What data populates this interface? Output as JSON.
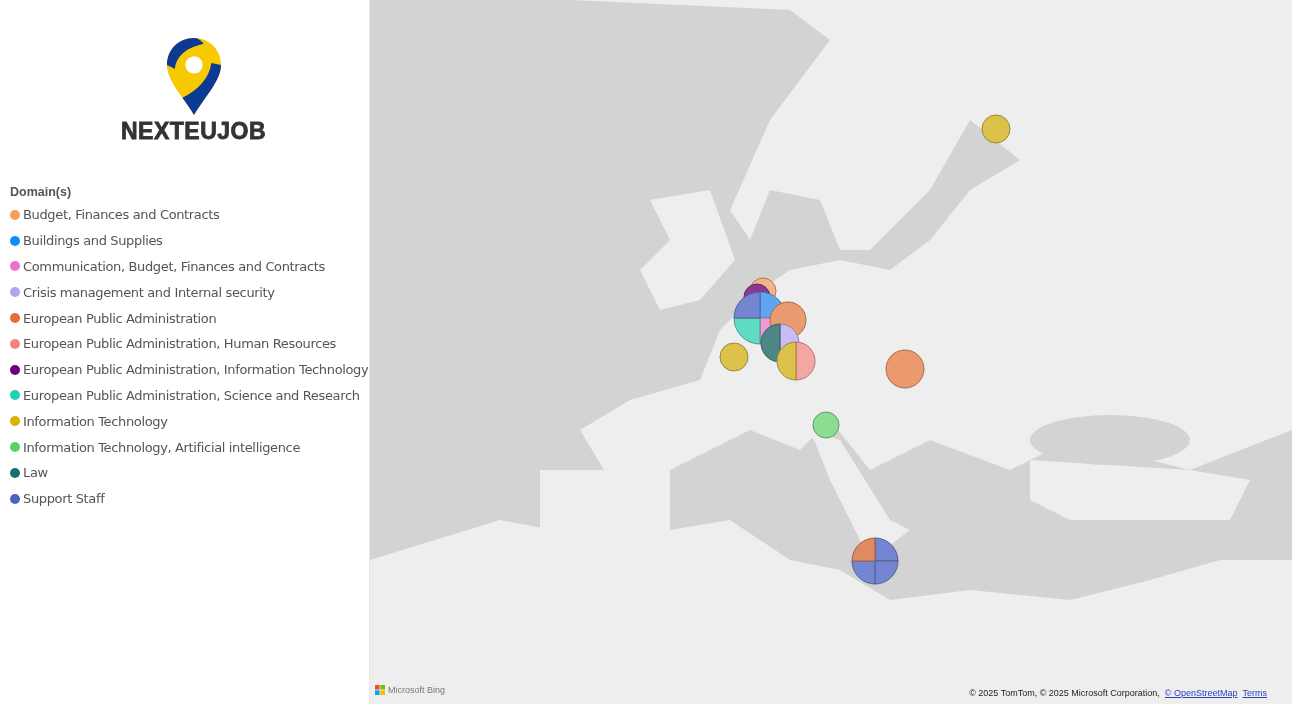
{
  "logo": {
    "name": "NEXTEUJOB"
  },
  "legend": {
    "title": "Domain(s)",
    "items": [
      {
        "label": "Budget, Finances and Contracts",
        "color": "#f5a05a"
      },
      {
        "label": "Buildings and Supplies",
        "color": "#118dff"
      },
      {
        "label": "Communication, Budget, Finances and Contracts",
        "color": "#ef6fcf"
      },
      {
        "label": "Crisis management and Internal security",
        "color": "#b3a3f7"
      },
      {
        "label": "European Public Administration",
        "color": "#e66c37"
      },
      {
        "label": "European Public Administration, Human Resources",
        "color": "#f28482"
      },
      {
        "label": "European Public Administration, Information Technology",
        "color": "#6b007b"
      },
      {
        "label": "European Public Administration, Science and Research",
        "color": "#1ed3b5"
      },
      {
        "label": "Information Technology",
        "color": "#d9b300"
      },
      {
        "label": "Information Technology, Artificial intelligence",
        "color": "#5fd068"
      },
      {
        "label": "Law",
        "color": "#196e6e"
      },
      {
        "label": "Support Staff",
        "color": "#4a62c4"
      }
    ]
  },
  "map": {
    "markers": [
      {
        "slices": [
          {
            "color": "#dcc24a"
          }
        ]
      },
      {
        "slices": [
          {
            "color": "#f2b48a"
          }
        ]
      },
      {
        "slices": [
          {
            "color": "#8a3a8e"
          }
        ]
      },
      {
        "slices": [
          {
            "color": "#5ea6f2"
          },
          {
            "color": "#f09ad8"
          },
          {
            "color": "#5fdcc6"
          },
          {
            "color": "#7486d2"
          }
        ]
      },
      {
        "slices": [
          {
            "color": "#eb9a70"
          }
        ]
      },
      {
        "slices": [
          {
            "color": "#dcc24a"
          }
        ]
      },
      {
        "slices": [
          {
            "color": "#c9bdf5"
          },
          {
            "color": "#4e8686"
          }
        ]
      },
      {
        "slices": [
          {
            "color": "#f4a6a4"
          },
          {
            "color": "#dcc24a"
          }
        ]
      },
      {
        "slices": [
          {
            "color": "#eb9a70"
          }
        ]
      },
      {
        "slices": [
          {
            "color": "#8edc92"
          }
        ]
      },
      {
        "slices": [
          {
            "color": "#7486d2"
          },
          {
            "color": "#7486d2"
          },
          {
            "color": "#7486d2"
          },
          {
            "color": "#e08a64"
          }
        ]
      }
    ],
    "provider": "Microsoft Bing",
    "attribution": "© 2025 TomTom, © 2025 Microsoft Corporation,",
    "links": [
      "© OpenStreetMap",
      "Terms"
    ]
  }
}
